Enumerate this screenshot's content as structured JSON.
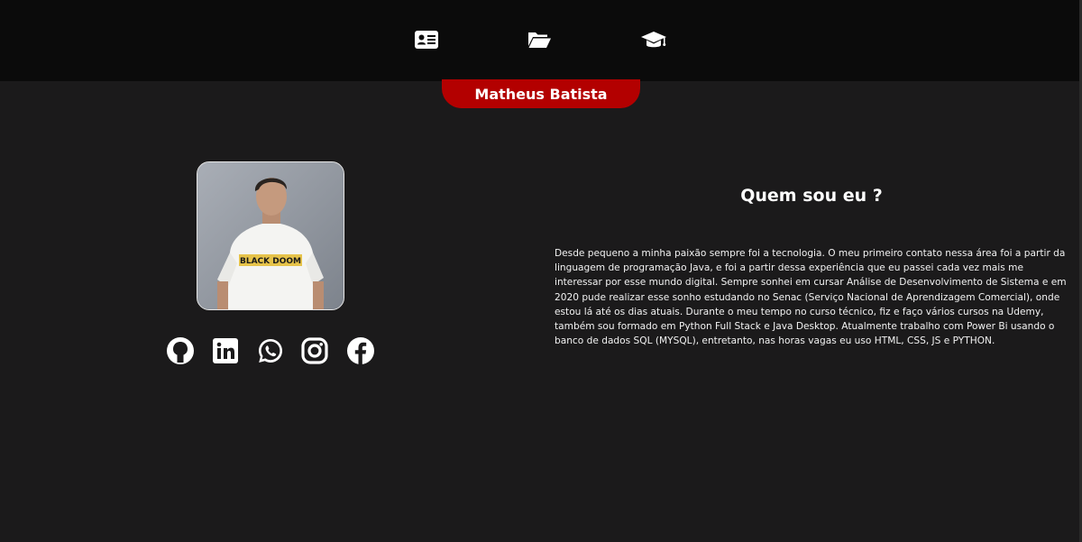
{
  "nav": {
    "items": [
      {
        "icon": "id-card-icon"
      },
      {
        "icon": "folder-open-icon"
      },
      {
        "icon": "graduation-cap-icon"
      }
    ]
  },
  "profile": {
    "name": "Matheus Batista",
    "photo_shirt_text": "BLACK DOOM"
  },
  "social": {
    "items": [
      {
        "icon": "github-icon"
      },
      {
        "icon": "linkedin-icon"
      },
      {
        "icon": "whatsapp-icon"
      },
      {
        "icon": "instagram-icon"
      },
      {
        "icon": "facebook-icon"
      }
    ]
  },
  "about": {
    "title": "Quem sou eu ?",
    "text": "Desde pequeno a minha paixão sempre foi a tecnologia. O meu primeiro contato nessa área foi a partir da linguagem de programação Java, e foi a partir dessa experiência que eu passei cada vez mais me interessar por esse mundo digital. Sempre sonhei em cursar Análise de Desenvolvimento de Sistema e em 2020 pude realizar esse sonho estudando no Senac (Serviço Nacional de Aprendizagem Comercial), onde estou lá até os dias atuais. Durante o meu tempo no curso técnico, fiz e faço vários cursos na Udemy, também sou formado em Python Full Stack e Java Desktop. Atualmente trabalho com Power Bi usando o banco de dados SQL (MYSQL), entretanto, nas horas vagas eu uso HTML, CSS, JS e PYTHON."
  },
  "colors": {
    "background": "#1b1a1b",
    "topbar": "#0b0b0b",
    "accent": "#b30000",
    "text": "#ffffff"
  }
}
